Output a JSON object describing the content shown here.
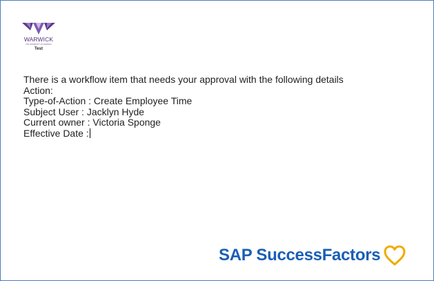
{
  "logo": {
    "name": "WARWICK",
    "subtitle": "THE UNIVERSITY OF WARWICK",
    "env_label": "Test",
    "colors": {
      "outer": "#5b3a8c",
      "mid": "#9b7cc5",
      "inner": "#cdb8e6"
    }
  },
  "message": {
    "intro": "There is a workflow item that needs your approval with the following details",
    "lines": [
      "Action:",
      "Type-of-Action : Create Employee Time",
      "Subject User : Jacklyn Hyde",
      "Current owner : Victoria Sponge",
      "Effective Date :"
    ]
  },
  "brand": {
    "name": "SAP SuccessFactors",
    "icon": "heart-outline-icon",
    "colors": {
      "text": "#1a5fb4",
      "heart": "#f0ab00"
    }
  },
  "colors": {
    "border": "#4a7ebb",
    "background": "#ffffff",
    "text": "#1f1f1f"
  }
}
